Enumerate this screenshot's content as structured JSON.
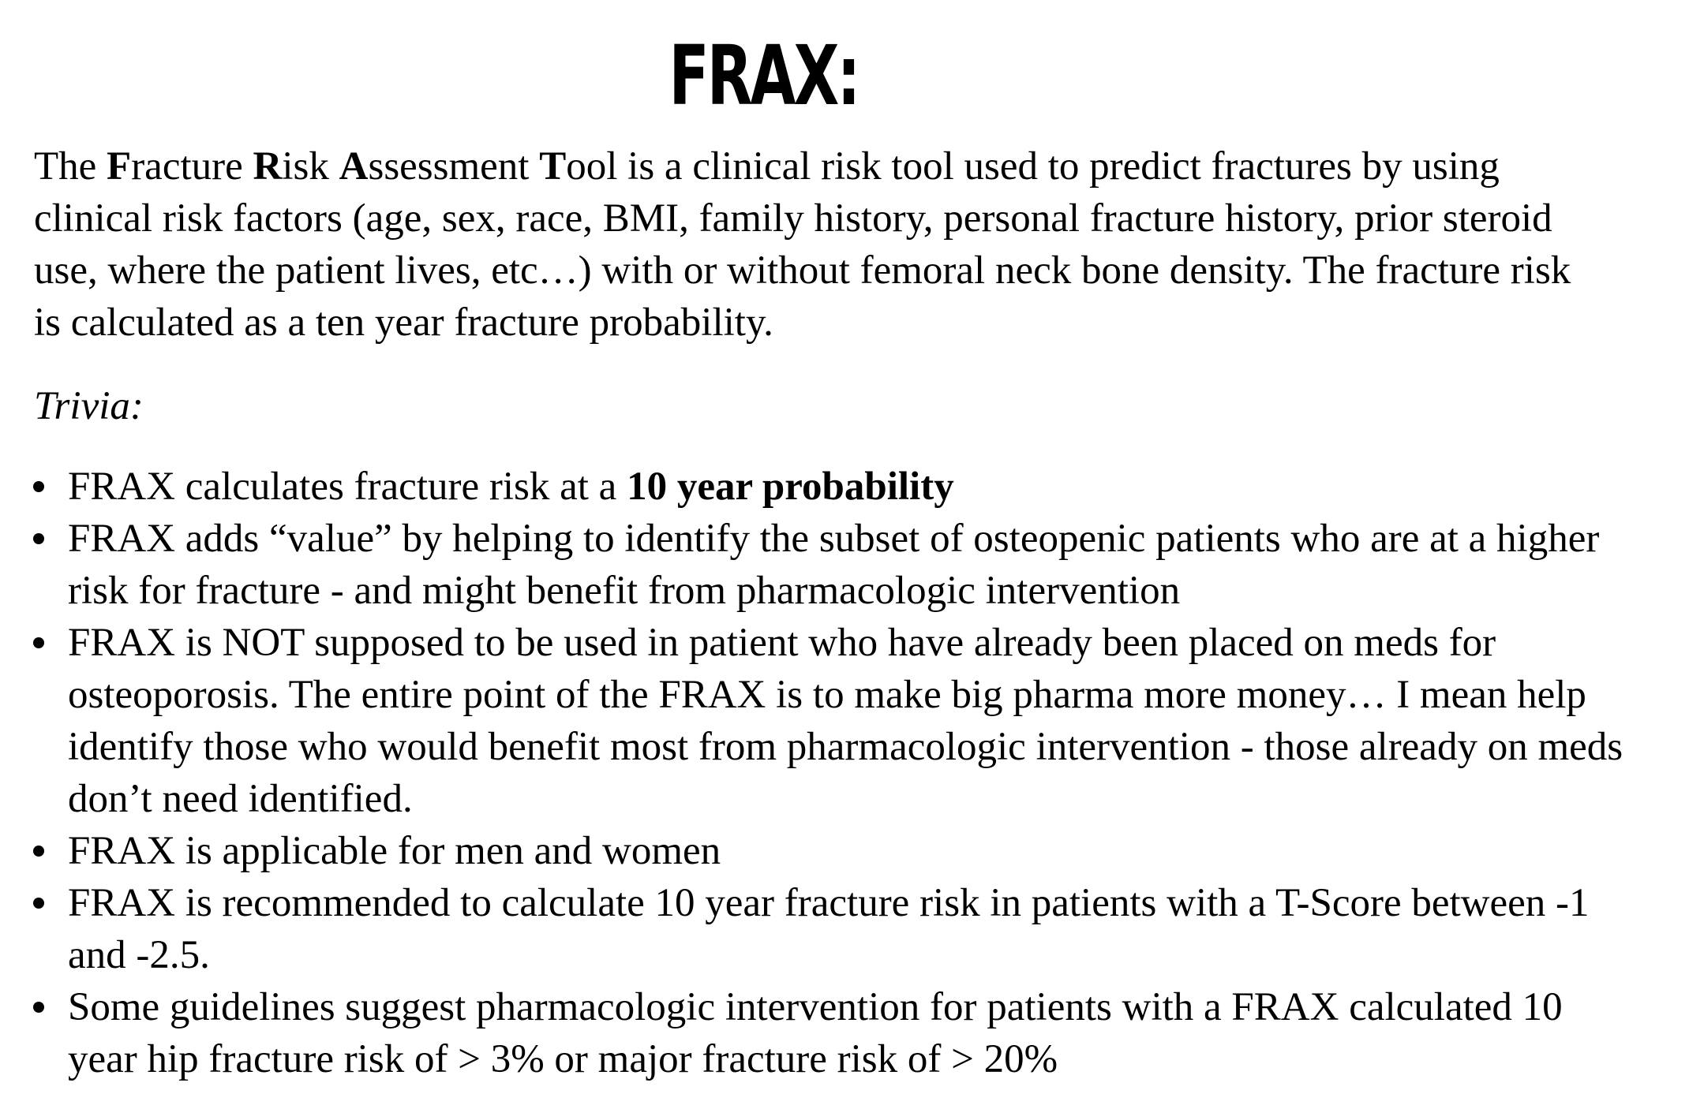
{
  "title": "FRAX:",
  "intro": {
    "t1": "The ",
    "b1": "F",
    "t2": "racture ",
    "b2": "R",
    "t3": "isk ",
    "b3": "A",
    "t4": "ssessment ",
    "b4": "T",
    "t5": "ool is a clinical risk tool used to predict fractures by using clinical risk factors (age, sex, race, BMI,  family history, personal fracture history, prior steroid use, where the patient lives, etc…) with or without femoral neck bone density.  The fracture risk is calculated as a ten year fracture probability."
  },
  "trivia_label": "Trivia:",
  "bullets": [
    {
      "text": "FRAX calculates fracture risk at a ",
      "bold": "10 year probability"
    },
    {
      "text": "FRAX adds “value” by helping to identify the subset of osteopenic patients who are at a higher risk for fracture - and might benefit from pharmacologic intervention"
    },
    {
      "text": "FRAX is NOT supposed to be used in patient who have already been placed on meds for osteoporosis. The entire point of the FRAX is to make big pharma more money… I mean help identify those who would benefit most from pharmacologic intervention - those already on meds don’t need identified."
    },
    {
      "text": "FRAX is applicable for men and women"
    },
    {
      "text": "FRAX is recommended to calculate 10 year fracture risk in patients with a T-Score between -1 and -2.5."
    },
    {
      "text": "Some guidelines suggest pharmacologic intervention for patients with a FRAX calculated 10 year hip fracture risk of > 3% or major fracture risk of > 20%"
    }
  ]
}
